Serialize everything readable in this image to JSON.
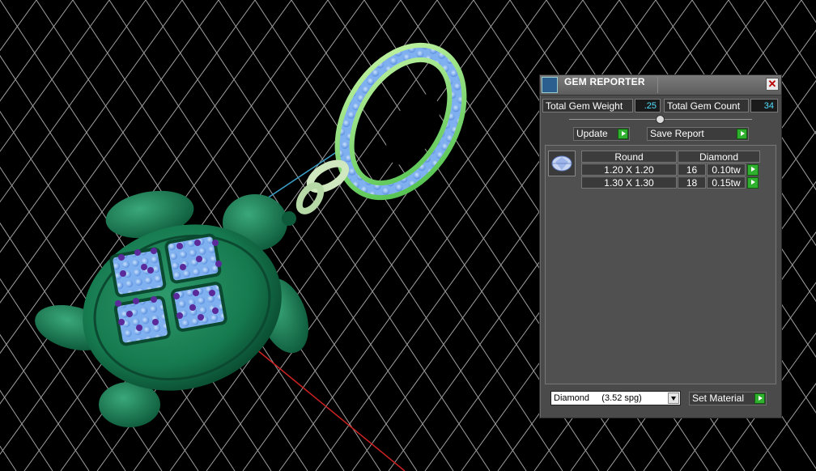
{
  "panel": {
    "title": "GEM REPORTER",
    "close_glyph": "✕",
    "total_gem_weight_label": "Total Gem Weight",
    "total_gem_weight_value": ".25",
    "total_gem_count_label": "Total Gem Count",
    "total_gem_count_value": "34",
    "update_label": "Update",
    "save_report_label": "Save Report",
    "table": {
      "shape_header": "Round",
      "material_header": "Diamond",
      "rows": [
        {
          "size": "1.20 X 1.20",
          "count": "16",
          "weight": "0.10tw"
        },
        {
          "size": "1.30 X 1.30",
          "count": "18",
          "weight": "0.15tw"
        }
      ]
    },
    "material_select_value": "Diamond     (3.52 spg)",
    "set_material_label": "Set Material"
  },
  "colors": {
    "accent_green": "#2fb02f",
    "value_cyan": "#4fe0ff",
    "panel_bg": "#4a4a4a"
  },
  "icons": [
    "app-icon",
    "close-icon",
    "go-arrow-icon",
    "gem-round-icon",
    "dropdown-arrow-icon"
  ]
}
